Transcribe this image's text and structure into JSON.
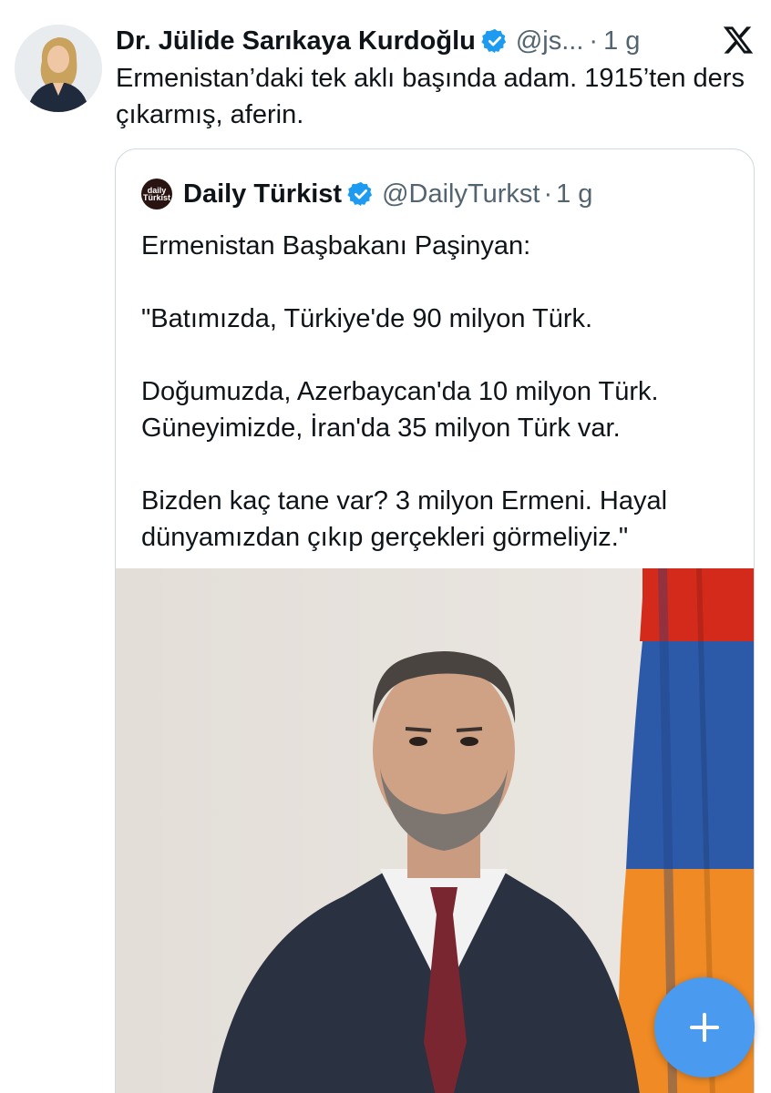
{
  "tweet": {
    "author_name": "Dr. Jülide Sarıkaya Kurdoğlu",
    "handle": "@js...",
    "separator": "·",
    "time": "1 g",
    "text": "Ermenistan’daki tek aklı başında adam. 1915’ten ders çıkarmış, aferin."
  },
  "quoted_tweet": {
    "avatar_label_1": "daily",
    "avatar_label_2": "Türkist",
    "author_name": "Daily Türkist",
    "handle": "@DailyTurkst",
    "separator": "·",
    "time": "1 g",
    "text": "Ermenistan Başbakanı Paşinyan:\n\n\"Batımızda, Türkiye'de 90 milyon Türk.\n\nDoğumuzda, Azerbaycan'da 10 milyon Türk.\nGüneyimizde, İran'da 35 milyon Türk var.\n\nBizden kaç tane var? 3 milyon Ermeni. Hayal dünyamızdan çıkıp gerçekleri görmeliyiz.\"",
    "image_icon": "portrait-photo"
  },
  "colors": {
    "verified": "#1d9bf0",
    "fab": "#4a9af0",
    "secondary_text": "#536471",
    "border": "#cfd9de",
    "flag_red": "#d32a1c",
    "flag_blue": "#2c5aa8",
    "flag_orange": "#ef8a24"
  },
  "icons": {
    "verified": "verified-badge-icon",
    "platform": "x-logo-icon",
    "compose": "plus-icon"
  }
}
